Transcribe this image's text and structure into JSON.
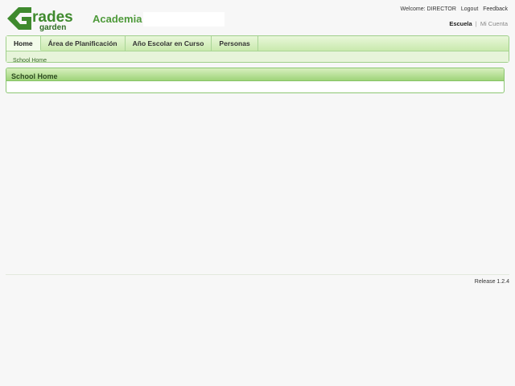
{
  "header": {
    "logo_text": "Grades garden",
    "school_label": "Academia",
    "welcome": "Welcome: DIRECTOR",
    "logout": "Logout",
    "feedback": "Feedback",
    "context": {
      "active": "Escuela",
      "separator": "|",
      "inactive": "Mi Cuenta"
    }
  },
  "nav": {
    "tabs": [
      {
        "label": "Home"
      },
      {
        "label": "Área de Planificación"
      },
      {
        "label": "Año Escolar en Curso"
      },
      {
        "label": "Personas"
      }
    ],
    "subnav_item": "School Home"
  },
  "main": {
    "panel_title": "School Home"
  },
  "footer": {
    "release": "Release 1.2.4"
  },
  "colors": {
    "brand_green": "#4e9a3a",
    "logo_dark_green": "#2f6e24",
    "panel_header": "#9fd47a",
    "nav_bg": "#dcefcb"
  }
}
